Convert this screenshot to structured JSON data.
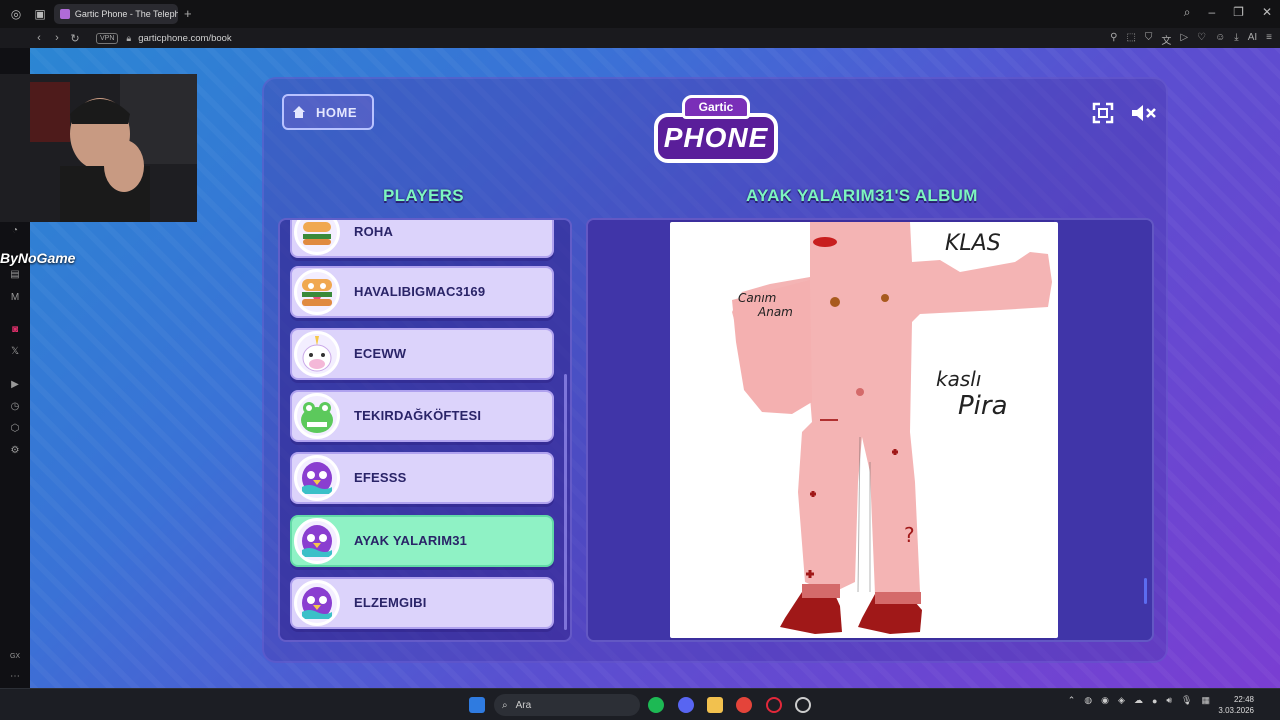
{
  "browser": {
    "tab_title": "Gartic Phone - The Teleph",
    "url": "garticphone.com/book",
    "vpn_label": "VPN"
  },
  "page": {
    "home_label": "HOME",
    "logo_top": "Gartic",
    "logo_bottom": "PHONE",
    "players_title": "PLAYERS",
    "album_title": "AYAK YALARIM31'S ALBUM"
  },
  "players": [
    {
      "name": "ROHA",
      "avatar": "burger-avatar"
    },
    {
      "name": "HAVALIBIGMAC3169",
      "avatar": "burger-avatar"
    },
    {
      "name": "ECEWW",
      "avatar": "unicorn-avatar"
    },
    {
      "name": "TEKIRDAĞKÖFTESI",
      "avatar": "frog-avatar"
    },
    {
      "name": "EFESSS",
      "avatar": "purple-bird-avatar"
    },
    {
      "name": "AYAK YALARIM31",
      "avatar": "purple-bird-avatar",
      "active": true
    },
    {
      "name": "ELZEMGIBI",
      "avatar": "purple-bird-avatar"
    }
  ],
  "drawing_text": {
    "t1": "KLAS",
    "t2": "Canım",
    "t3": "Anam",
    "t4": "kaslı",
    "t5": "Pira",
    "t6": "?"
  },
  "stream": {
    "tag": "ByNoGame"
  },
  "taskbar": {
    "search_placeholder": "Ara",
    "time": "22:48",
    "date": "3.03.2026"
  },
  "colors": {
    "accent_title": "#7df5c0",
    "active_player": "#8ff2c5",
    "player_card": "#dcd3fb"
  }
}
